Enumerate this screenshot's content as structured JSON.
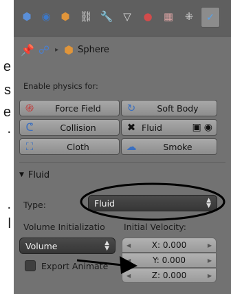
{
  "side_text": [
    "e",
    "s",
    "e",
    "."
  ],
  "side_text_lower": [
    ".",
    "l"
  ],
  "tabs": [
    {
      "name": "render-tab",
      "glyph": "⬢",
      "color": "#5a8fd8"
    },
    {
      "name": "world-tab",
      "glyph": "◉",
      "color": "#3c78c8"
    },
    {
      "name": "object-tab",
      "glyph": "⬢",
      "color": "#e0953a"
    },
    {
      "name": "constraints-tab",
      "glyph": "⛓",
      "color": "#cfcfcf"
    },
    {
      "name": "modifiers-tab",
      "glyph": "🔧",
      "color": "#cfcfcf"
    },
    {
      "name": "data-tab",
      "glyph": "▽",
      "color": "#cfcfcf"
    },
    {
      "name": "material-tab",
      "glyph": "●",
      "color": "#d24b4b"
    },
    {
      "name": "texture-tab",
      "glyph": "▦",
      "color": "#d7a1a1"
    },
    {
      "name": "particles-tab",
      "glyph": "⁜",
      "color": "#dcdcdc"
    },
    {
      "name": "physics-tab",
      "glyph": "✓",
      "color": "#5aa0e6"
    }
  ],
  "breadcrumb": {
    "pin": "📌",
    "scene_icon": "☍",
    "separator": "▸",
    "object_icon": "⬢",
    "object": "Sphere"
  },
  "enable_label": "Enable physics for:",
  "physics_buttons": {
    "force_field": "Force Field",
    "soft_body": "Soft Body",
    "collision": "Collision",
    "fluid": "Fluid",
    "cloth": "Cloth",
    "smoke": "Smoke"
  },
  "fluid_section": {
    "title": "Fluid",
    "type_label": "Type:",
    "type_value": "Fluid",
    "volume_init_label": "Volume Initializatio",
    "volume_value": "Volume",
    "export_animated": "Export Animate",
    "initial_velocity_label": "Initial Velocity:",
    "velocity": {
      "x": "X: 0.000",
      "y": "Y: 0.000",
      "z": "Z: 0.000"
    }
  },
  "colors": {
    "panel": "#727272",
    "button": "#9a9a9a",
    "dark_select": "#3e3e3e",
    "annotation": "#000000"
  }
}
